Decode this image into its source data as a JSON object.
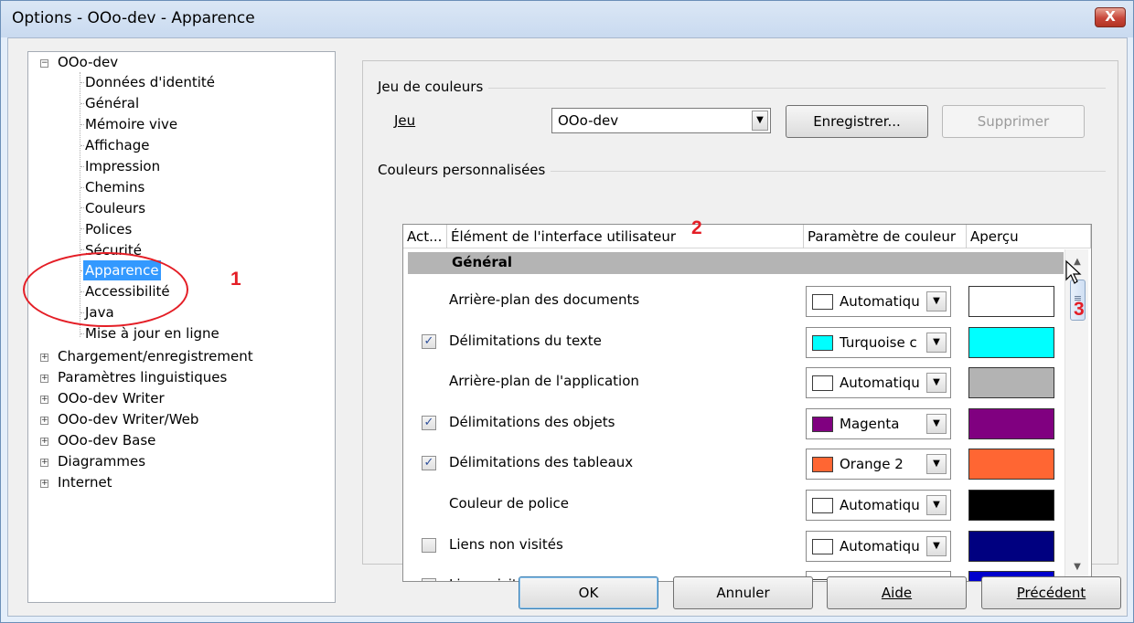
{
  "window": {
    "title": "Options - OOo-dev - Apparence",
    "close_label": "X"
  },
  "tree": {
    "root": "OOo-dev",
    "children": [
      "Données d'identité",
      "Général",
      "Mémoire vive",
      "Affichage",
      "Impression",
      "Chemins",
      "Couleurs",
      "Polices",
      "Sécurité",
      "Apparence",
      "Accessibilité",
      "Java",
      "Mise à jour en ligne"
    ],
    "selected": "Apparence",
    "others": [
      "Chargement/enregistrement",
      "Paramètres linguistiques",
      "OOo-dev Writer",
      "OOo-dev Writer/Web",
      "OOo-dev Base",
      "Diagrammes",
      "Internet"
    ]
  },
  "annotations": [
    "1",
    "2",
    "3"
  ],
  "scheme": {
    "group_label": "Jeu de couleurs",
    "label": "Jeu",
    "value": "OOo-dev",
    "save_label": "Enregistrer...",
    "delete_label": "Supprimer"
  },
  "custom": {
    "group_label": "Couleurs personnalisées",
    "columns": [
      "Act...",
      "Élément de l'interface utilisateur",
      "Paramètre de couleur",
      "Aperçu"
    ],
    "section": "Général",
    "rows": [
      {
        "checkbox": false,
        "checked": false,
        "label": "Arrière-plan des documents",
        "color_name": "Automatiqu",
        "swatch": "#ffffff",
        "preview": "#ffffff"
      },
      {
        "checkbox": true,
        "checked": true,
        "label": "Délimitations du texte",
        "color_name": "Turquoise c",
        "swatch": "#00ffff",
        "preview": "#00ffff"
      },
      {
        "checkbox": false,
        "checked": false,
        "label": "Arrière-plan de l'application",
        "color_name": "Automatiqu",
        "swatch": "#ffffff",
        "preview": "#b3b3b3"
      },
      {
        "checkbox": true,
        "checked": true,
        "label": "Délimitations des objets",
        "color_name": "Magenta",
        "swatch": "#800080",
        "preview": "#800080"
      },
      {
        "checkbox": true,
        "checked": true,
        "label": "Délimitations des tableaux",
        "color_name": "Orange 2",
        "swatch": "#ff6633",
        "preview": "#ff6633"
      },
      {
        "checkbox": false,
        "checked": false,
        "label": "Couleur de police",
        "color_name": "Automatiqu",
        "swatch": "#ffffff",
        "preview": "#000000"
      },
      {
        "checkbox": true,
        "checked": false,
        "label": "Liens non visités",
        "color_name": "Automatiqu",
        "swatch": "#ffffff",
        "preview": "#000080"
      },
      {
        "checkbox": true,
        "checked": false,
        "label": "Liens visités",
        "color_name": "",
        "swatch": "#ffffff",
        "preview": "#0000cc"
      }
    ]
  },
  "buttons": {
    "ok": "OK",
    "cancel": "Annuler",
    "help": "Aide",
    "back": "Précédent"
  },
  "icons": {
    "checkmark": "check-icon",
    "dropdown": "chevron-down-icon",
    "expand": "plus-icon",
    "collapse": "minus-icon"
  }
}
